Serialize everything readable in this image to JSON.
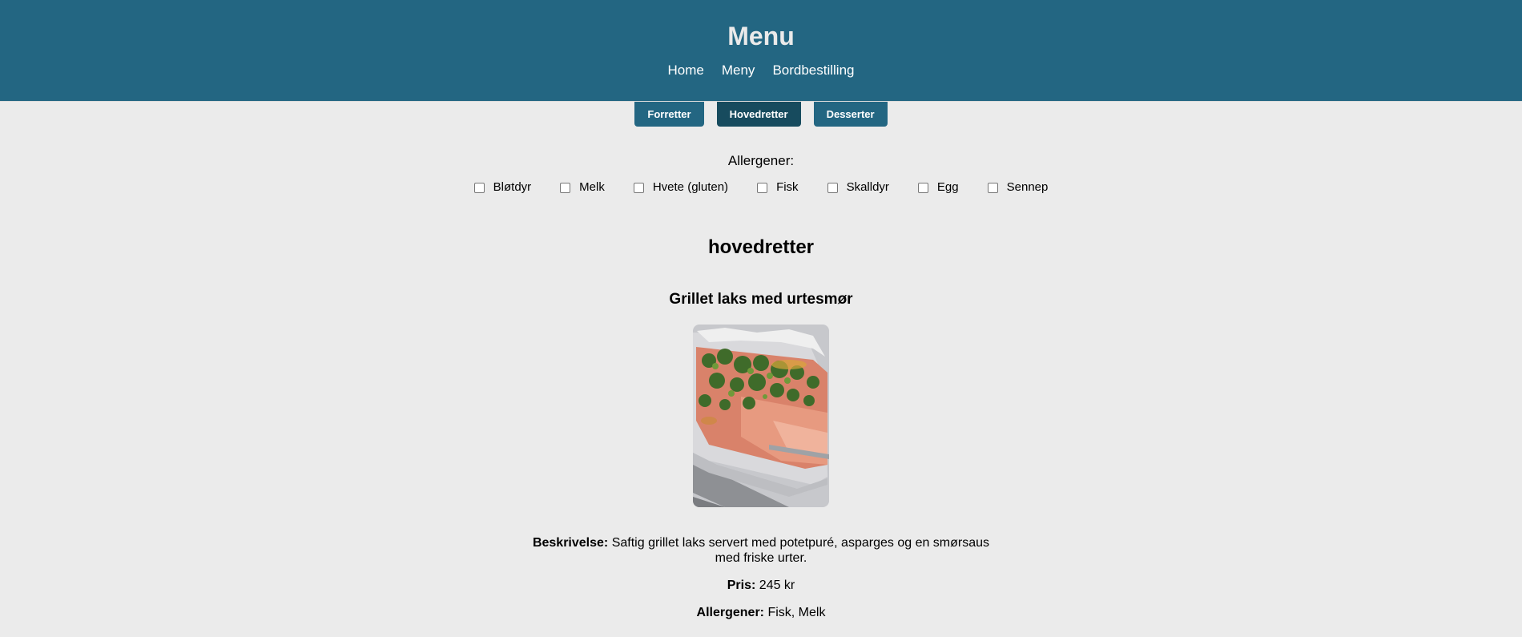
{
  "header": {
    "title": "Menu",
    "nav": [
      "Home",
      "Meny",
      "Bordbestilling"
    ]
  },
  "tabs": [
    {
      "label": "Forretter",
      "active": false
    },
    {
      "label": "Hovedretter",
      "active": true
    },
    {
      "label": "Desserter",
      "active": false
    }
  ],
  "allergens": {
    "title": "Allergener:",
    "options": [
      "Bløtdyr",
      "Melk",
      "Hvete (gluten)",
      "Fisk",
      "Skalldyr",
      "Egg",
      "Sennep"
    ]
  },
  "section": {
    "title": "hovedretter"
  },
  "dish": {
    "name": "Grillet laks med urtesmør",
    "description_label": "Beskrivelse:",
    "description": "Saftig grillet laks servert med potetpuré, asparges og en smørsaus med friske urter.",
    "price_label": "Pris:",
    "price": "245 kr",
    "allergens_label": "Allergener:",
    "allergens": "Fisk, Melk"
  },
  "colors": {
    "header_bg": "#236682",
    "tab_bg": "#236682",
    "tab_active_bg": "#174b5e",
    "page_bg": "#ebebeb"
  }
}
